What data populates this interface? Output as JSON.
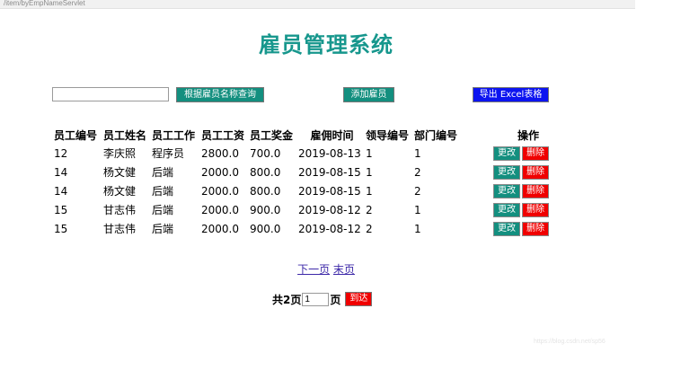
{
  "browser": {
    "url_fragment": "/item/byEmpNameServlet"
  },
  "page": {
    "title": "雇员管理系统"
  },
  "toolbar": {
    "search_value": "",
    "search_button": "根据雇员名称查询",
    "add_button": "添加雇员",
    "export_button": "导出 Excel表格"
  },
  "table": {
    "headers": {
      "id": "员工编号",
      "name": "员工姓名",
      "job": "员工工作",
      "salary": "员工工资",
      "bonus": "员工奖金",
      "hire_time": "雇佣时间",
      "leader": "领导编号",
      "dept": "部门编号",
      "ops": "操作"
    },
    "edit_label": "更改",
    "delete_label": "删除",
    "rows": [
      {
        "id": "12",
        "name": "李庆照",
        "job": "程序员",
        "salary": "2800.0",
        "bonus": "700.0",
        "hire_time": "2019-08-13",
        "leader": "1",
        "dept": "1"
      },
      {
        "id": "14",
        "name": "杨文健",
        "job": "后端",
        "salary": "2000.0",
        "bonus": "800.0",
        "hire_time": "2019-08-15",
        "leader": "1",
        "dept": "2"
      },
      {
        "id": "14",
        "name": "杨文健",
        "job": "后端",
        "salary": "2000.0",
        "bonus": "800.0",
        "hire_time": "2019-08-15",
        "leader": "1",
        "dept": "2"
      },
      {
        "id": "15",
        "name": "甘志伟",
        "job": "后端",
        "salary": "2000.0",
        "bonus": "900.0",
        "hire_time": "2019-08-12",
        "leader": "2",
        "dept": "1"
      },
      {
        "id": "15",
        "name": "甘志伟",
        "job": "后端",
        "salary": "2000.0",
        "bonus": "900.0",
        "hire_time": "2019-08-12",
        "leader": "2",
        "dept": "1"
      }
    ]
  },
  "pagination": {
    "next_label": "下一页",
    "last_label": "末页",
    "total_prefix": "共2页",
    "page_value": "1",
    "page_suffix": "页",
    "go_label": "到达"
  },
  "watermark": "https://blog.csdn.net/sp56"
}
